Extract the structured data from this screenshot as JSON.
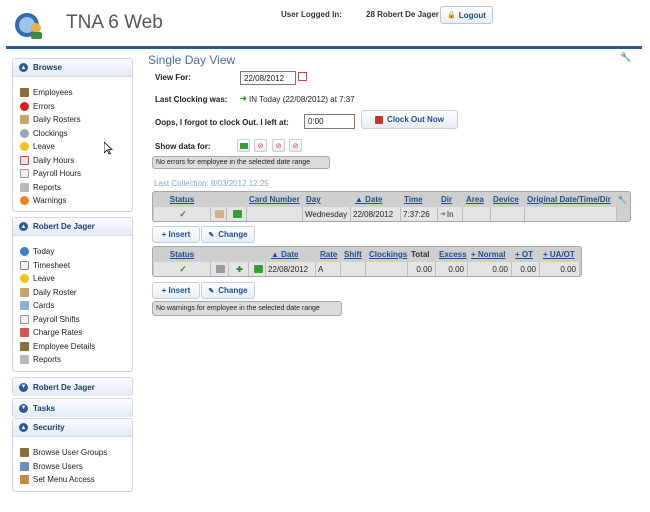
{
  "header": {
    "app_title": "TNA 6 Web",
    "user_logged_label": "User Logged In:",
    "user_name": "28 Robert De Jager",
    "logout_label": "Logout"
  },
  "sidebar": {
    "browse": {
      "title": "Browse",
      "items": [
        {
          "label": "Employees",
          "icon": "employees-icon"
        },
        {
          "label": "Errors",
          "icon": "errors-icon"
        },
        {
          "label": "Daily Rosters",
          "icon": "daily-rosters-icon"
        },
        {
          "label": "Clockings",
          "icon": "clock-icon"
        },
        {
          "label": "Leave",
          "icon": "leave-icon"
        },
        {
          "label": "Daily Hours",
          "icon": "calendar-icon"
        },
        {
          "label": "Payroll Hours",
          "icon": "payroll-icon"
        },
        {
          "label": "Reports",
          "icon": "printer-icon"
        },
        {
          "label": "Warnings",
          "icon": "warning-icon"
        }
      ]
    },
    "employee": {
      "title": "Robert De Jager",
      "items": [
        {
          "label": "Today",
          "icon": "globe-icon"
        },
        {
          "label": "Timesheet",
          "icon": "timesheet-icon"
        },
        {
          "label": "Leave",
          "icon": "leave-icon"
        },
        {
          "label": "Daily Roster",
          "icon": "roster-icon"
        },
        {
          "label": "Cards",
          "icon": "cards-icon"
        },
        {
          "label": "Payroll Shifts",
          "icon": "payroll-icon"
        },
        {
          "label": "Charge Rates",
          "icon": "charge-icon"
        },
        {
          "label": "Employee Details",
          "icon": "employee-details-icon"
        },
        {
          "label": "Reports",
          "icon": "printer-icon"
        }
      ]
    },
    "collapsed1": "Robert De Jager",
    "tasks": "Tasks",
    "security": {
      "title": "Security",
      "items": [
        {
          "label": "Browse User Groups",
          "icon": "user-groups-icon"
        },
        {
          "label": "Browse Users",
          "icon": "users-icon"
        },
        {
          "label": "Set Menu Access",
          "icon": "access-icon"
        }
      ]
    }
  },
  "main": {
    "heading": "Single Day View",
    "view_for_label": "View For:",
    "view_for_value": "22/08/2012",
    "last_clocking_label": "Last Clocking was:",
    "last_clocking_value": "IN Today (22/08/2012) at 7:37",
    "forgot_label": "Oops, I forgot to clock Out. I left at:",
    "forgot_value": "0:00",
    "clock_out_label": "Clock Out Now",
    "show_data_label": "Show data for:",
    "no_errors_msg": "No errors for employee in the selected date range",
    "last_collection": "Last Collection: 8/03/2012 12:25",
    "clockings_table": {
      "headers": [
        "Status",
        "",
        "",
        "Card Number",
        "Day",
        "▲ Date",
        "Time",
        "Dir",
        "Area",
        "Device",
        "Original Date/Time/Dir"
      ],
      "row": {
        "status": "✓",
        "card_number": "",
        "day": "Wednesday",
        "date": "22/08/2012",
        "time": "7:37:26",
        "dir": "In",
        "area": "",
        "device": "",
        "original": ""
      }
    },
    "insert_label": "+ Insert",
    "change_label": "Change",
    "hours_table": {
      "headers": [
        "Status",
        "",
        "",
        "",
        "▲ Date",
        "Rate",
        "Shift",
        "Clockings",
        "Total",
        "Excess",
        "+ Normal",
        "+ OT",
        "+ UA/OT"
      ],
      "row": {
        "status": "✓",
        "date": "22/08/2012",
        "rate": "A",
        "shift": "",
        "clockings": "",
        "total": "0.00",
        "excess": "0.00",
        "normal": "0.00",
        "ot": "0.00",
        "uaot": "0.00"
      }
    },
    "no_warnings_msg": "No warnings for employee in the selected date range"
  }
}
